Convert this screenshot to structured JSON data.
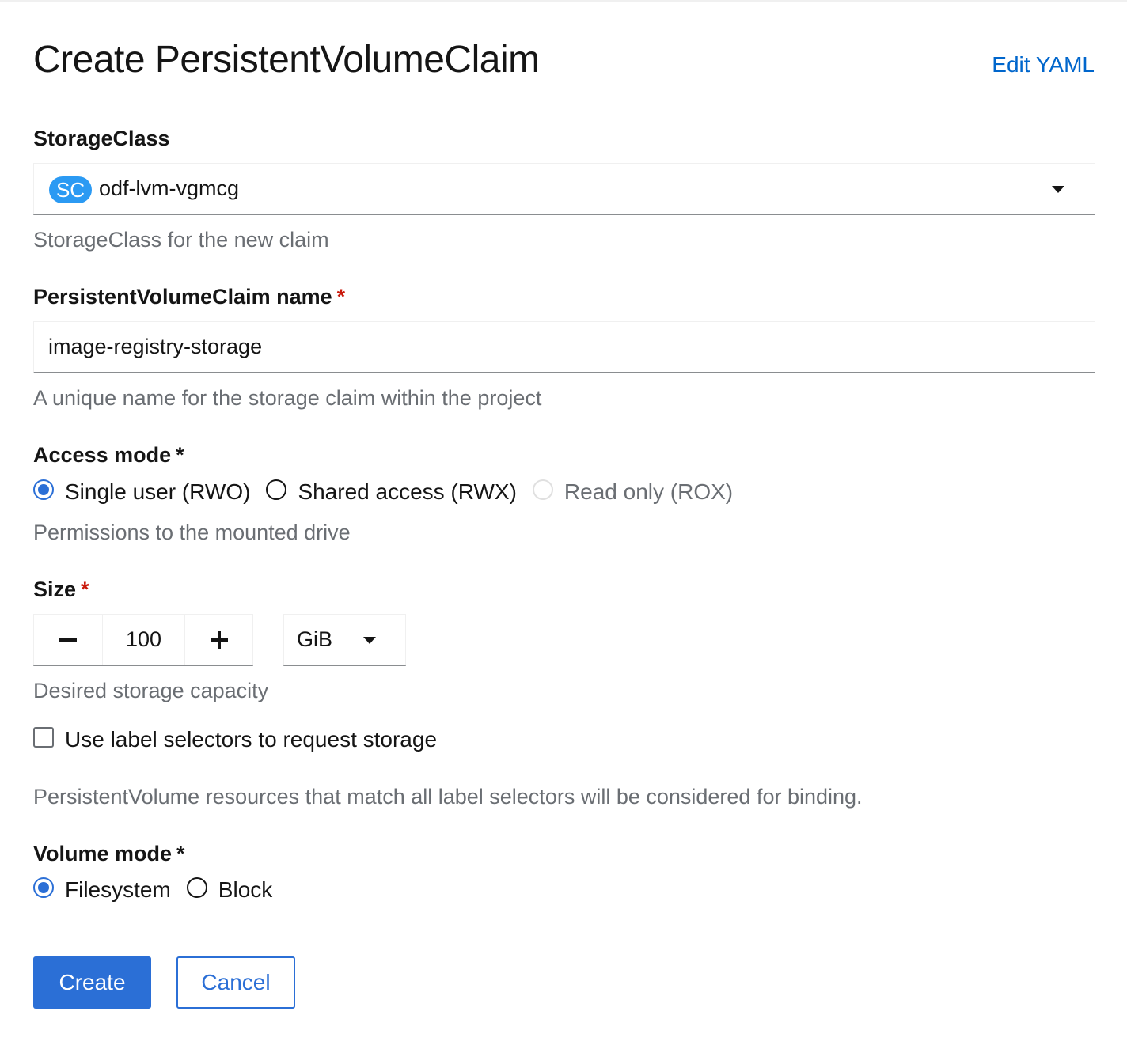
{
  "page": {
    "title": "Create PersistentVolumeClaim",
    "edit_yaml_link": "Edit YAML"
  },
  "storage_class": {
    "label": "StorageClass",
    "badge": "SC",
    "value": "odf-lvm-vgmcg",
    "help": "StorageClass for the new claim"
  },
  "pvc_name": {
    "label": "PersistentVolumeClaim name",
    "required_marker": "*",
    "value": "image-registry-storage",
    "help": "A unique name for the storage claim within the project"
  },
  "access_mode": {
    "label": "Access mode",
    "required_marker": "*",
    "options": [
      {
        "label": "Single user (RWO)",
        "checked": true,
        "disabled": false
      },
      {
        "label": "Shared access (RWX)",
        "checked": false,
        "disabled": false
      },
      {
        "label": "Read only (ROX)",
        "checked": false,
        "disabled": true
      }
    ],
    "help": "Permissions to the mounted drive"
  },
  "size": {
    "label": "Size",
    "required_marker": "*",
    "value": "100",
    "unit": "GiB",
    "help": "Desired storage capacity"
  },
  "label_selectors": {
    "checkbox_label": "Use label selectors to request storage",
    "checked": false,
    "help": "PersistentVolume resources that match all label selectors will be considered for binding."
  },
  "volume_mode": {
    "label": "Volume mode",
    "required_marker": "*",
    "options": [
      {
        "label": "Filesystem",
        "checked": true
      },
      {
        "label": "Block",
        "checked": false
      }
    ]
  },
  "actions": {
    "create": "Create",
    "cancel": "Cancel"
  },
  "colors": {
    "primary": "#2b6fd6",
    "link": "#0066cc",
    "required": "#c9190b",
    "badge": "#2b9af3"
  }
}
